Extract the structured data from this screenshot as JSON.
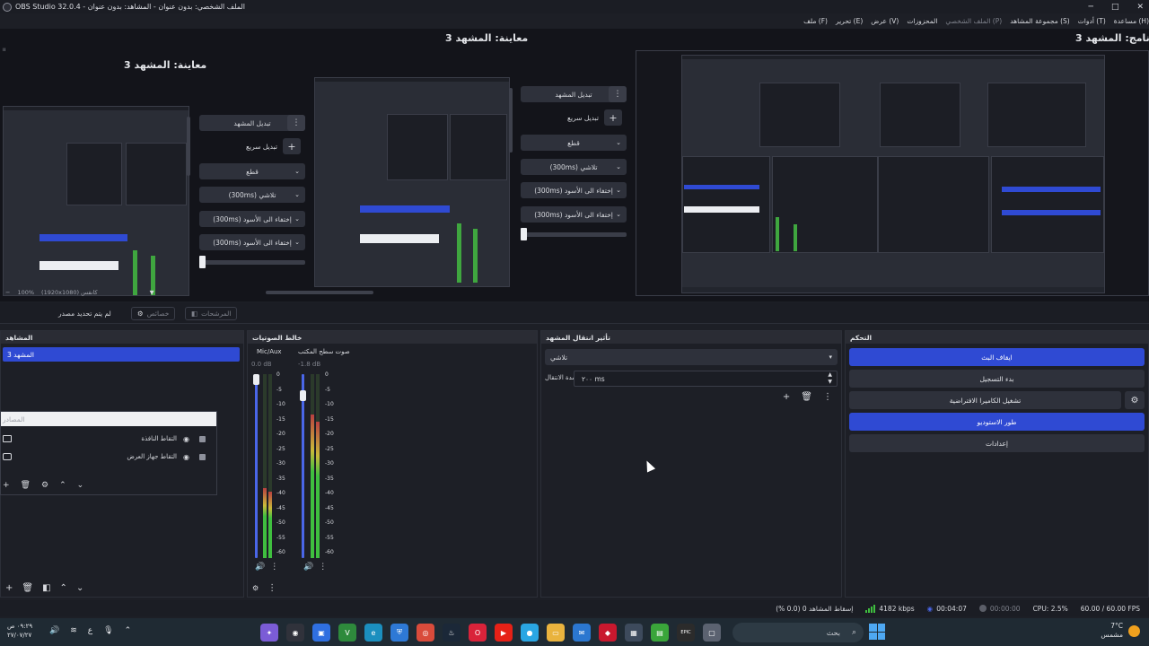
{
  "window": {
    "title": "OBS Studio 32.0.4 - الملف الشخصي: بدون عنوان - المشاهد: بدون عنوان",
    "minimize": "─",
    "maximize": "□",
    "close": "✕"
  },
  "menu": [
    "(F) ملف",
    "(E) تحرير",
    "(V) عرض",
    "المحزوزات",
    "(P) الملف الشخصي",
    "(S) مجموعة المشاهد",
    "(T) أدوات",
    "(H) مساعدة"
  ],
  "preview": {
    "left_label": "معاينة: المشهد 3",
    "mid_label": "معاينة: المشهد 3",
    "program_label": "برنامج: المشهد 3",
    "corner_mark": "ıı",
    "quick_transition_buttons": [
      {
        "label": "تبديل المشهد",
        "kind": "dots"
      },
      {
        "label": "تبديل سريع",
        "kind": "plus"
      },
      {
        "label": "قطع",
        "kind": "dropdown"
      },
      {
        "label": "(300ms) تلاشي",
        "kind": "dropdown"
      },
      {
        "label": "(300ms) إختفاء الى الأسود",
        "kind": "dropdown"
      },
      {
        "label": "(300ms) إختفاء الى الأسود",
        "kind": "dropdown"
      }
    ]
  },
  "zoom": {
    "minus": "−",
    "level": "100%",
    "resolution": "(1920x1080) كانفس",
    "chevron": "▼"
  },
  "source_toolbar": {
    "no_source": "لم يتم تحديد مصدر",
    "properties": "خصائص",
    "filters": "المرشحات"
  },
  "scenes": {
    "title": "المشاهد",
    "items": [
      "المشهد 3"
    ]
  },
  "sources": {
    "title": "المصادر",
    "items": [
      {
        "name": "التقاط النافذة",
        "icon": "window-icon"
      },
      {
        "name": "التقاط جهاز العرض",
        "icon": "monitor-icon"
      }
    ]
  },
  "docks": {
    "audio_title": "خالط الصوتيات",
    "transitions_title": "تأثير انتقال المشهد",
    "controls_title": "التحكم"
  },
  "audio": {
    "scale": [
      "0",
      "-5",
      "-10",
      "-15",
      "-20",
      "-25",
      "-30",
      "-35",
      "-40",
      "-45",
      "-50",
      "-55",
      "-60"
    ],
    "channels": [
      {
        "name": "Mic/Aux",
        "db": "0.0 dB",
        "level": 0.38
      },
      {
        "name": "صوت سطح المكتب",
        "db": "-1.8 dB",
        "level": 0.78
      }
    ]
  },
  "transitions": {
    "selected": "تلاشي",
    "duration_label": "مدة الانتقال",
    "duration_value": "٢٠٠ ms"
  },
  "controls": [
    {
      "label": "ايقاف البث",
      "active": true
    },
    {
      "label": "بدء التسجيل",
      "active": false
    },
    {
      "label": "تشغيل الكاميرا الافتراضية",
      "active": false,
      "gear": true
    },
    {
      "label": "طور الاستوديو",
      "active": true
    },
    {
      "label": "إعدادات",
      "active": false
    }
  ],
  "status": {
    "dropped": "إسقاط المشاهد 0 (0.0 %)",
    "bitrate": "4182 kbps",
    "stream_time": "00:04:07",
    "rec_time": "00:00:00",
    "cpu": "CPU: 2.5%",
    "fps": "60.00 / 60.00 FPS"
  },
  "taskbar": {
    "time": "٠٩:٢٩ ص",
    "date": "٢٧/٠٧/٢٧",
    "lang": "ع",
    "search_placeholder": "بحث",
    "weather_temp": "7°C",
    "weather_desc": "مشمس",
    "apps": [
      {
        "name": "copilot-icon",
        "color": "#7b5cd6",
        "glyph": "✦"
      },
      {
        "name": "obs-icon",
        "color": "#30323b",
        "glyph": "◉"
      },
      {
        "name": "app-blue-icon",
        "color": "#2f6fe0",
        "glyph": "▣"
      },
      {
        "name": "vim-icon",
        "color": "#2e8a3c",
        "glyph": "V"
      },
      {
        "name": "edge-icon",
        "color": "#1b8fbf",
        "glyph": "e"
      },
      {
        "name": "shield-icon",
        "color": "#2e79d6",
        "glyph": "⛨"
      },
      {
        "name": "chrome-icon",
        "color": "#d94b3b",
        "glyph": "◎"
      },
      {
        "name": "steam-icon",
        "color": "#1b2838",
        "glyph": "♨"
      },
      {
        "name": "opera-icon",
        "color": "#d9233a",
        "glyph": "O"
      },
      {
        "name": "youtube-icon",
        "color": "#e62117",
        "glyph": "▶"
      },
      {
        "name": "app-circle-icon",
        "color": "#2aa6e3",
        "glyph": "●"
      },
      {
        "name": "folder-icon",
        "color": "#e9b33e",
        "glyph": "▭"
      },
      {
        "name": "mail-icon",
        "color": "#2b77d0",
        "glyph": "✉"
      },
      {
        "name": "red-app-icon",
        "color": "#c9182e",
        "glyph": "◆"
      },
      {
        "name": "store-icon",
        "color": "#3d4a5c",
        "glyph": "▦"
      },
      {
        "name": "green-app-icon",
        "color": "#3aa53a",
        "glyph": "▤"
      },
      {
        "name": "epic-icon",
        "color": "#2b2b2b",
        "glyph": "EPIC"
      },
      {
        "name": "app-gray-icon",
        "color": "#5b6270",
        "glyph": "▢"
      }
    ]
  }
}
